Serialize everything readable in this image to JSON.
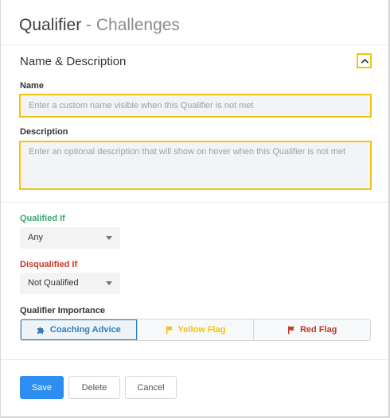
{
  "header": {
    "title_main": "Qualifier",
    "title_sub": " - Challenges"
  },
  "section": {
    "title": "Name & Description",
    "collapse_icon": "chevron-up-icon"
  },
  "fields": {
    "name_label": "Name",
    "name_placeholder": "Enter a custom name visible when this Qualifier is not met",
    "description_label": "Description",
    "description_placeholder": "Enter an optional description that will show on hover when this Qualifier is not met"
  },
  "qualified": {
    "label": "Qualified If",
    "value": "Any",
    "color": "#3aa76d"
  },
  "disqualified": {
    "label": "Disqualified If",
    "value": "Not Qualified",
    "color": "#c0392b"
  },
  "importance": {
    "label": "Qualifier Importance",
    "options": [
      {
        "label": "Coaching Advice",
        "icon": "puzzle-piece-icon",
        "active": true,
        "color": "#2f7ec0"
      },
      {
        "label": "Yellow Flag",
        "icon": "flag-icon",
        "active": false,
        "color": "#f2c40f"
      },
      {
        "label": "Red Flag",
        "icon": "flag-icon",
        "active": false,
        "color": "#c0392b"
      }
    ]
  },
  "footer": {
    "save_label": "Save",
    "delete_label": "Delete",
    "cancel_label": "Cancel"
  },
  "colors": {
    "accent": "#2b8ef0",
    "focus_outline": "#f2c40f"
  }
}
